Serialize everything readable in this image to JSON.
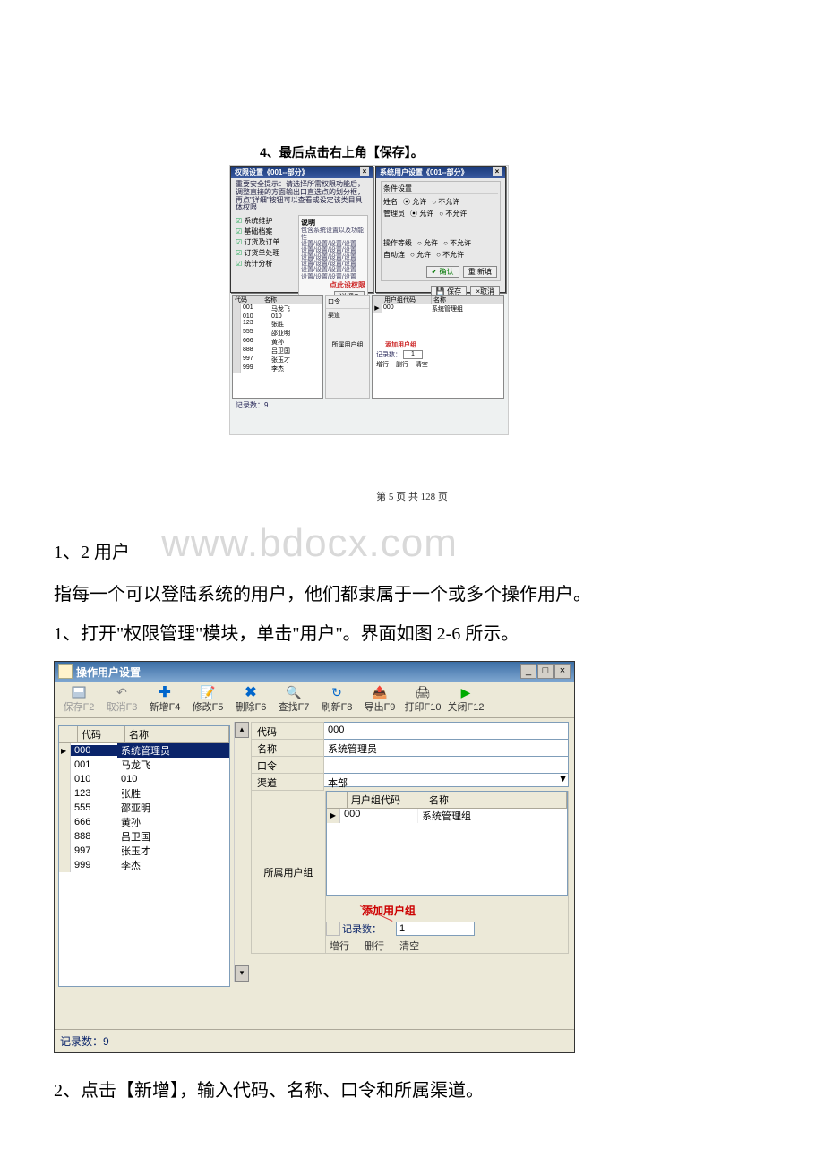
{
  "upper": {
    "caption": "4、最后点击右上角【保存】。",
    "dlg1_title": "权限设置《001--部分》",
    "dlg1_note": "重要安全提示：请选择所需权限功能后，调整直接的方面输出口直选点的划分框，再点\"详细\"按钮可以查看或设定该类目具体权限",
    "chk": [
      "系统维护",
      "基础档案",
      "订货及订单",
      "订货单处理",
      "统计分析"
    ],
    "desc_label": "说明",
    "desc_text": "包含系统设置以及功能性\n设置/设置/设置/设置\n设置/设置/设置/设置\n设置/设置/设置/设置\n设置/设置/设置/设置\n设置/设置/设置/设置\n设置/设置/设置/设置",
    "desc_link": "点此设权限",
    "detail_btn": "详细Q",
    "save_btn": "保存",
    "cancel_btn": "×取消",
    "dlg2_title": "系统用户设置《001--部分》",
    "dlg2_tab": "条件设置",
    "row_labels": [
      "姓名",
      "管理员"
    ],
    "opts": [
      "允许",
      "不允许"
    ],
    "extra1": "操作等级",
    "extra2": "自动连",
    "ok_btn": "✔ 确认",
    "reset_btn": "重 新填",
    "lower_save": "保存",
    "lower_cancel": "×取消",
    "grid_left_head": [
      "代码",
      "名称"
    ],
    "grid_left_rows": [
      [
        "001",
        "马龙飞"
      ],
      [
        "010",
        "010"
      ],
      [
        "123",
        "张胜"
      ],
      [
        "555",
        "邵亚明"
      ],
      [
        "666",
        "黄孙"
      ],
      [
        "888",
        "吕卫国"
      ],
      [
        "997",
        "张玉才"
      ],
      [
        "999",
        "李杰"
      ]
    ],
    "mid_labels": [
      "口令",
      "渠道"
    ],
    "mid_group_label": "所属用户组",
    "right_head": [
      "用户组代码",
      "名称"
    ],
    "right_row": [
      "000",
      "系统管理组"
    ],
    "add_link": "添加用户组",
    "rec_label": "记录数：",
    "rec_val": "1",
    "rec_btns": [
      "增行",
      "删行",
      "清空"
    ],
    "footer": "记录数：9"
  },
  "page_number": "第 5 页 共 128 页",
  "watermark": "www.bdocx.com",
  "section_heading": "1、2 用户",
  "para1": "指每一个可以登陆系统的用户，他们都隶属于一个或多个操作用户。",
  "para2": "1、打开\"权限管理\"模块，单击\"用户\"。界面如图 2-6 所示。",
  "mainwin": {
    "title": "操作用户设置",
    "toolbar": [
      {
        "key": "save",
        "label": "保存F2",
        "disabled": true
      },
      {
        "key": "cancel",
        "label": "取消F3",
        "disabled": true
      },
      {
        "key": "new",
        "label": "新增F4"
      },
      {
        "key": "edit",
        "label": "修改F5"
      },
      {
        "key": "delete",
        "label": "删除F6"
      },
      {
        "key": "find",
        "label": "查找F7"
      },
      {
        "key": "refresh",
        "label": "刷新F8"
      },
      {
        "key": "export",
        "label": "导出F9"
      },
      {
        "key": "print",
        "label": "打印F10"
      },
      {
        "key": "close",
        "label": "关闭F12"
      }
    ],
    "left_head": [
      "代码",
      "名称"
    ],
    "left_rows": [
      {
        "code": "000",
        "name": "系统管理员",
        "sel": true
      },
      {
        "code": "001",
        "name": "马龙飞"
      },
      {
        "code": "010",
        "name": "010"
      },
      {
        "code": "123",
        "name": "张胜"
      },
      {
        "code": "555",
        "name": "邵亚明"
      },
      {
        "code": "666",
        "name": "黄孙"
      },
      {
        "code": "888",
        "name": "吕卫国"
      },
      {
        "code": "997",
        "name": "张玉才"
      },
      {
        "code": "999",
        "name": "李杰"
      }
    ],
    "form": {
      "code_lb": "代码",
      "code_val": "000",
      "name_lb": "名称",
      "name_val": "系统管理员",
      "pwd_lb": "口令",
      "pwd_val": "",
      "chan_lb": "渠道",
      "chan_val": "本部",
      "group_lb": "所属用户组"
    },
    "group_head": [
      "用户组代码",
      "名称"
    ],
    "group_row": {
      "code": "000",
      "name": "系统管理组"
    },
    "add_group": "添加用户组",
    "rec_lb": "记录数：",
    "rec_val": "1",
    "row_btns": [
      "增行",
      "删行",
      "清空"
    ],
    "footer": "记录数：9"
  },
  "para3": "2、点击【新增】，输入代码、名称、口令和所属渠道。"
}
